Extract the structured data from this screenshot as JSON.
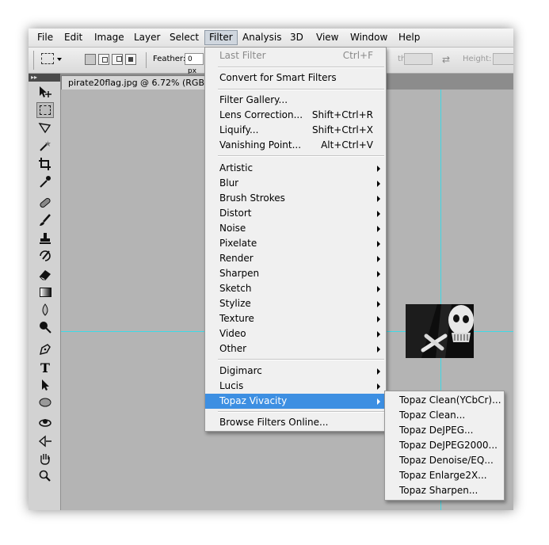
{
  "menubar": {
    "items": [
      {
        "label": "File"
      },
      {
        "label": "Edit"
      },
      {
        "label": "Image"
      },
      {
        "label": "Layer"
      },
      {
        "label": "Select"
      },
      {
        "label": "Filter",
        "active": true
      },
      {
        "label": "Analysis"
      },
      {
        "label": "3D"
      },
      {
        "label": "View"
      },
      {
        "label": "Window"
      },
      {
        "label": "Help"
      }
    ]
  },
  "options_bar": {
    "feather_label": "Feather:",
    "feather_value": "0 px",
    "width_label": "th:",
    "height_label": "Height:",
    "swap_icon": "swap-arrows-icon"
  },
  "document": {
    "tab_title": "pirate20flag.jpg @ 6.72% (RGB/8"
  },
  "filter_menu": {
    "last_filter": {
      "label": "Last Filter",
      "mnemonic": "F",
      "shortcut": "Ctrl+F",
      "enabled": false
    },
    "convert_smart": {
      "label": "Convert for Smart Filters"
    },
    "group1": [
      {
        "label": "Filter Gallery...",
        "mnemonic": "G",
        "shortcut": ""
      },
      {
        "label": "Lens Correction...",
        "mnemonic": "r",
        "shortcut": "Shift+Ctrl+R"
      },
      {
        "label": "Liquify...",
        "mnemonic": "L",
        "shortcut": "Shift+Ctrl+X"
      },
      {
        "label": "Vanishing Point...",
        "mnemonic": "V",
        "shortcut": "Alt+Ctrl+V"
      }
    ],
    "group2": [
      {
        "label": "Artistic"
      },
      {
        "label": "Blur"
      },
      {
        "label": "Brush Strokes"
      },
      {
        "label": "Distort"
      },
      {
        "label": "Noise"
      },
      {
        "label": "Pixelate"
      },
      {
        "label": "Render"
      },
      {
        "label": "Sharpen"
      },
      {
        "label": "Sketch"
      },
      {
        "label": "Stylize"
      },
      {
        "label": "Texture"
      },
      {
        "label": "Video"
      },
      {
        "label": "Other"
      }
    ],
    "group3": [
      {
        "label": "Digimarc"
      },
      {
        "label": "Lucis"
      },
      {
        "label": "Topaz Vivacity",
        "highlighted": true
      }
    ],
    "browse_online": {
      "label": "Browse Filters Online..."
    }
  },
  "topaz_submenu": {
    "items": [
      {
        "label": "Topaz Clean(YCbCr)..."
      },
      {
        "label": "Topaz Clean..."
      },
      {
        "label": "Topaz DeJPEG..."
      },
      {
        "label": "Topaz DeJPEG2000..."
      },
      {
        "label": "Topaz Denoise/EQ..."
      },
      {
        "label": "Topaz Enlarge2X..."
      },
      {
        "label": "Topaz Sharpen..."
      }
    ]
  },
  "colors": {
    "menu_highlight": "#3d8fe2",
    "guide": "#3ed9e6",
    "canvas": "#b4b4b4"
  }
}
